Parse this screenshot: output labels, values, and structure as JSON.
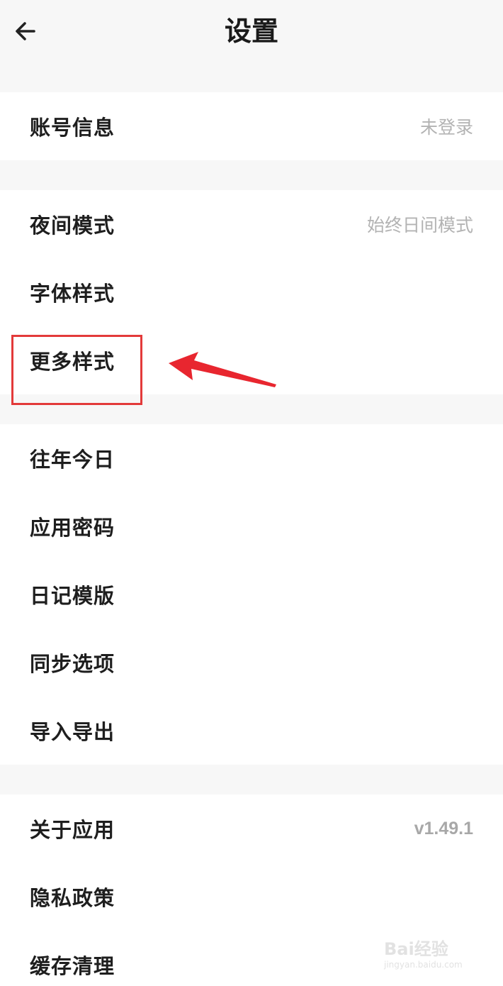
{
  "header": {
    "title": "设置",
    "back_icon": "arrow-left-icon"
  },
  "groups": [
    {
      "items": [
        {
          "label": "账号信息",
          "value": "未登录"
        }
      ]
    },
    {
      "items": [
        {
          "label": "夜间模式",
          "value": "始终日间模式"
        },
        {
          "label": "字体样式",
          "value": ""
        },
        {
          "label": "更多样式",
          "value": ""
        }
      ]
    },
    {
      "items": [
        {
          "label": "往年今日",
          "value": ""
        },
        {
          "label": "应用密码",
          "value": ""
        },
        {
          "label": "日记模版",
          "value": ""
        },
        {
          "label": "同步选项",
          "value": ""
        },
        {
          "label": "导入导出",
          "value": ""
        }
      ]
    },
    {
      "items": [
        {
          "label": "关于应用",
          "value": "v1.49.1"
        },
        {
          "label": "隐私政策",
          "value": ""
        },
        {
          "label": "缓存清理",
          "value": ""
        }
      ]
    }
  ],
  "annotation": {
    "highlight_color": "#e33a3a",
    "arrow_color": "#e8262f"
  },
  "watermark": {
    "logo": "Bai经验",
    "url": "jingyan.baidu.com"
  },
  "colors": {
    "background": "#f7f7f7",
    "card": "#ffffff",
    "text": "#1e1e1e",
    "secondary": "#b3b3b3"
  }
}
